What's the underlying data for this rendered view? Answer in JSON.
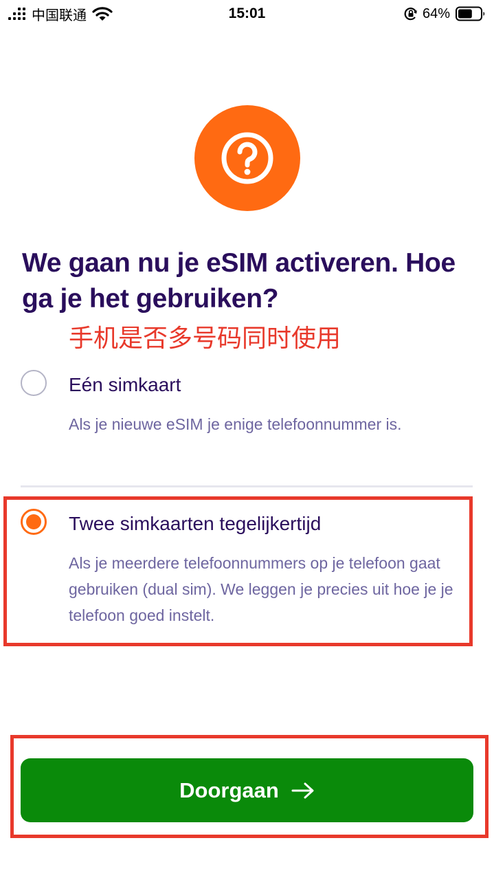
{
  "status_bar": {
    "carrier": "中国联通",
    "time": "15:01",
    "battery_percent": "64%",
    "battery_level": 0.64,
    "icons": [
      "signal-icon",
      "wifi-icon",
      "rotation-lock-icon",
      "battery-icon"
    ]
  },
  "hero": {
    "icon": "question-mark-icon",
    "color": "#ff6a12"
  },
  "title": "We gaan nu je eSIM activeren. Hoe ga je het gebruiken?",
  "annotation": "手机是否多号码同时使用",
  "options": [
    {
      "label": "Eén simkaart",
      "description": "Als je nieuwe eSIM je enige telefoonnummer is.",
      "selected": false
    },
    {
      "label": "Twee simkaarten tegelijkertijd",
      "description": "Als je meerdere telefoonnummers op je telefoon gaat gebruiken (dual sim). We leggen je precies uit hoe je je telefoon goed instelt.",
      "selected": true
    }
  ],
  "continue_button": {
    "label": "Doorgaan",
    "icon": "arrow-right-icon",
    "color": "#0a8a0a"
  },
  "colors": {
    "accent": "#ff6a12",
    "heading": "#2a0e5c",
    "body_text": "#6e66a0",
    "annotation_red": "#e8392b"
  }
}
